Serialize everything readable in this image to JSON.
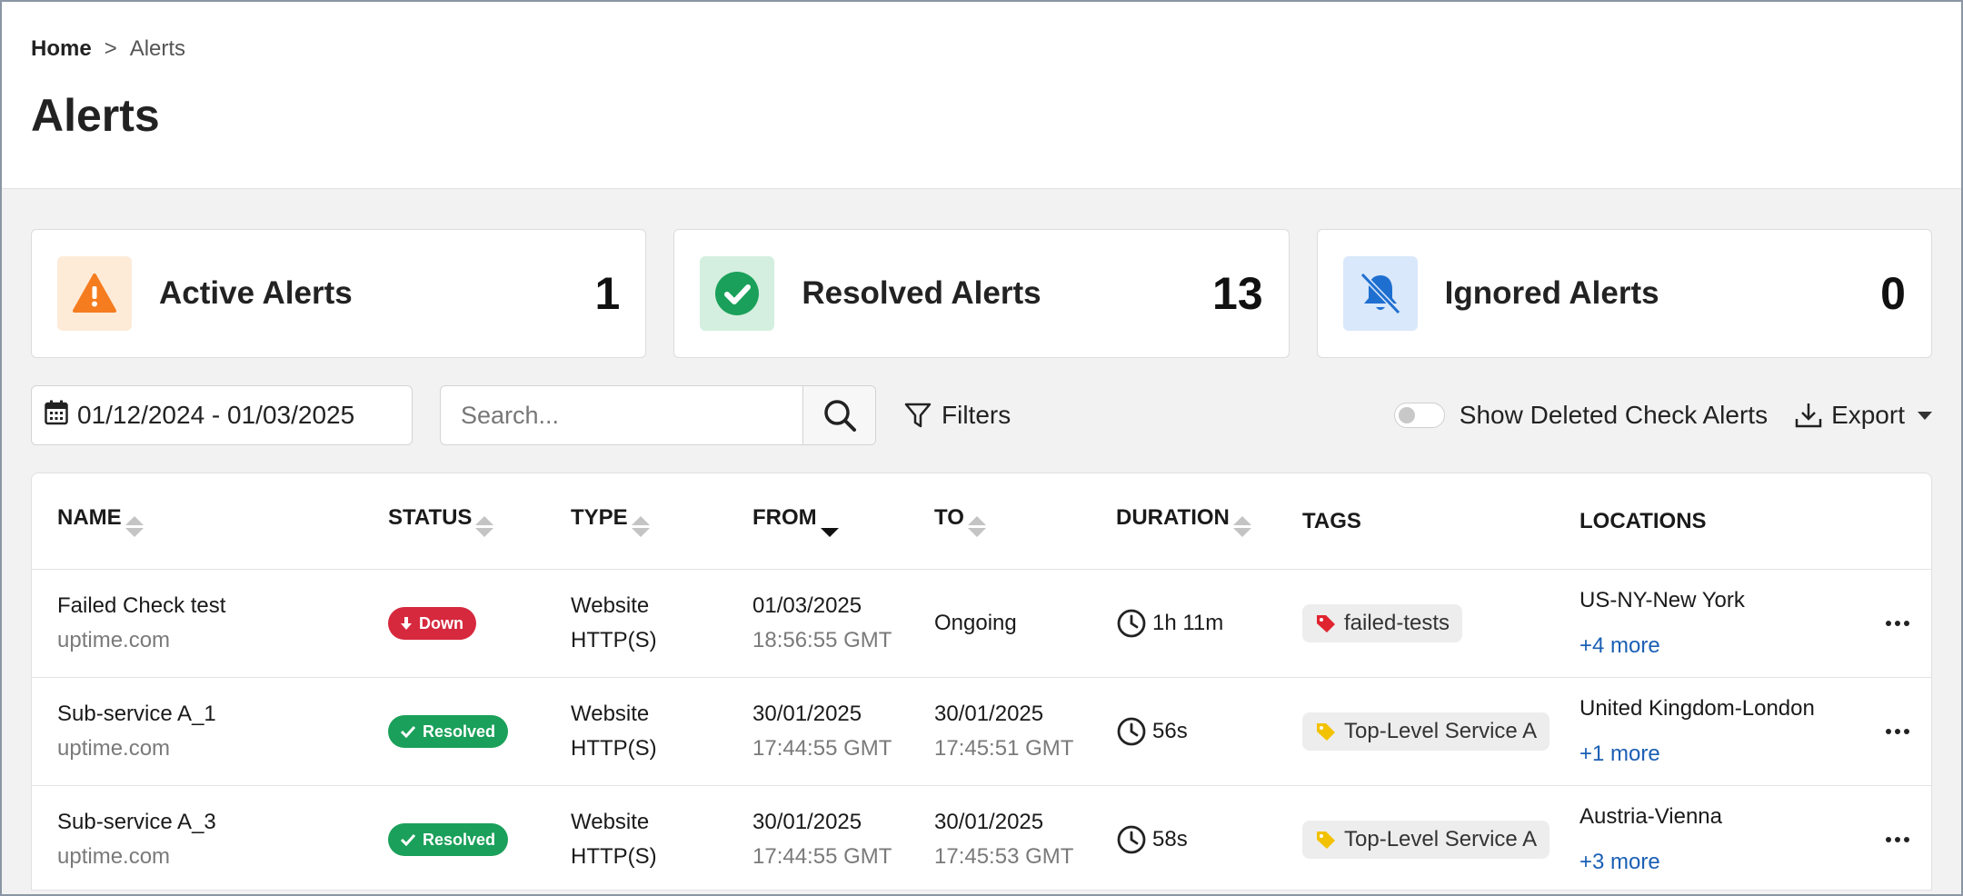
{
  "breadcrumb": {
    "home": "Home",
    "separator": ">",
    "current": "Alerts"
  },
  "page_title": "Alerts",
  "summary": [
    {
      "label": "Active Alerts",
      "count": "1",
      "icon": "warning-icon",
      "bg": "#fdebd8",
      "color": "#f57c1f"
    },
    {
      "label": "Resolved Alerts",
      "count": "13",
      "icon": "check-circle-icon",
      "bg": "#d4efdf",
      "color": "#1aa05a"
    },
    {
      "label": "Ignored Alerts",
      "count": "0",
      "icon": "bell-off-icon",
      "bg": "#d9e8fa",
      "color": "#1f6fd1"
    }
  ],
  "toolbar": {
    "date_range": "01/12/2024 - 01/03/2025",
    "search_placeholder": "Search...",
    "filters_label": "Filters",
    "show_deleted_label": "Show Deleted Check Alerts",
    "export_label": "Export"
  },
  "table": {
    "columns": [
      "NAME",
      "STATUS",
      "TYPE",
      "FROM",
      "TO",
      "DURATION",
      "TAGS",
      "LOCATIONS"
    ],
    "rows": [
      {
        "name": "Failed Check test",
        "domain": "uptime.com",
        "status": "Down",
        "status_type": "down",
        "type1": "Website",
        "type2": "HTTP(S)",
        "from_date": "01/03/2025",
        "from_time": "18:56:55 GMT",
        "to_date": "Ongoing",
        "to_time": "",
        "duration": "1h 11m",
        "tag": "failed-tests",
        "tag_color": "#e0242f",
        "location": "US-NY-New York",
        "more": "+4 more"
      },
      {
        "name": "Sub-service A_1",
        "domain": "uptime.com",
        "status": "Resolved",
        "status_type": "resolved",
        "type1": "Website",
        "type2": "HTTP(S)",
        "from_date": "30/01/2025",
        "from_time": "17:44:55 GMT",
        "to_date": "30/01/2025",
        "to_time": "17:45:51 GMT",
        "duration": "56s",
        "tag": "Top-Level Service A",
        "tag_color": "#f2c200",
        "location": "United Kingdom-London",
        "more": "+1 more"
      },
      {
        "name": "Sub-service A_3",
        "domain": "uptime.com",
        "status": "Resolved",
        "status_type": "resolved",
        "type1": "Website",
        "type2": "HTTP(S)",
        "from_date": "30/01/2025",
        "from_time": "17:44:55 GMT",
        "to_date": "30/01/2025",
        "to_time": "17:45:53 GMT",
        "duration": "58s",
        "tag": "Top-Level Service A",
        "tag_color": "#f2c200",
        "location": "Austria-Vienna",
        "more": "+3 more"
      }
    ]
  }
}
